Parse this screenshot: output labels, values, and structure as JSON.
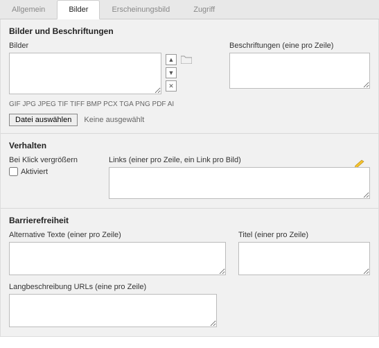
{
  "tabs": {
    "t0": "Allgemein",
    "t1": "Bilder",
    "t2": "Erscheinungsbild",
    "t3": "Zugriff"
  },
  "sec1": {
    "title": "Bilder und Beschriftungen",
    "bilder_label": "Bilder",
    "captions_label": "Beschriftungen (eine pro Zeile)",
    "formats": "GIF JPG JPEG TIF TIFF BMP PCX TGA PNG PDF AI",
    "choose_btn": "Datei auswählen",
    "choose_status": "Keine ausgewählt"
  },
  "sec2": {
    "title": "Verhalten",
    "enlarge_label": "Bei Klick vergrößern",
    "activated": "Aktiviert",
    "links_label": "Links (einer pro Zeile, ein Link pro Bild)"
  },
  "sec3": {
    "title": "Barrierefreiheit",
    "alt_label": "Alternative Texte (einer pro Zeile)",
    "title_label": "Titel (einer pro Zeile)",
    "longdesc_label": "Langbeschreibung URLs (eine pro Zeile)"
  }
}
